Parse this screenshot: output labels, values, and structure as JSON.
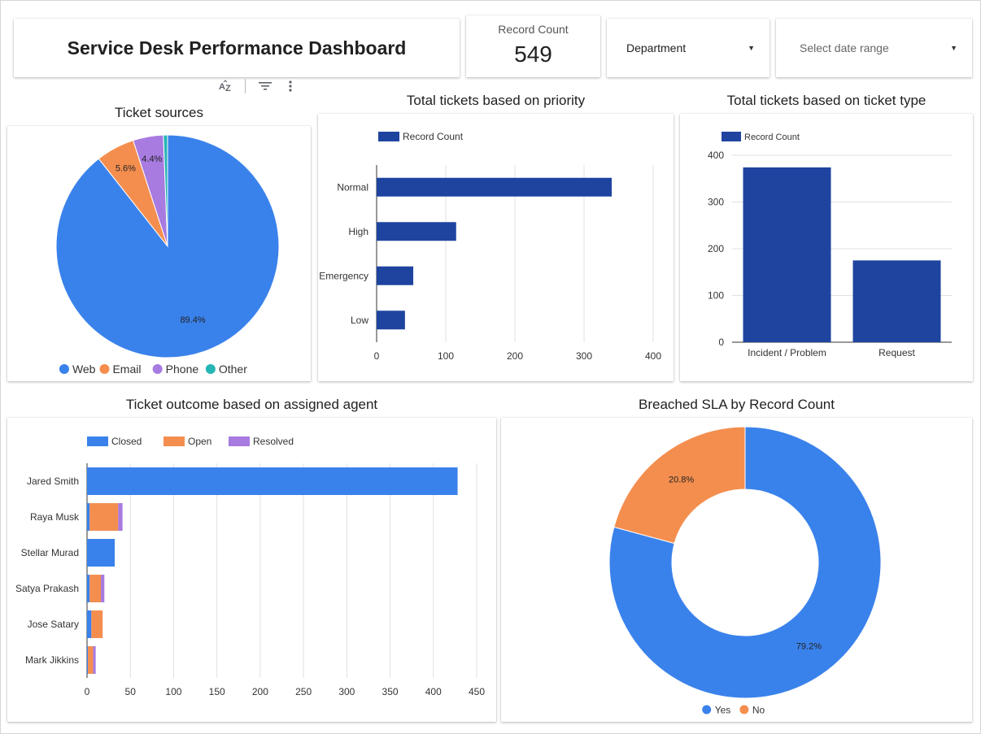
{
  "dashboard": {
    "title": "Service Desk Performance Dashboard"
  },
  "scorecard": {
    "label": "Record Count",
    "value": "549"
  },
  "filters": {
    "department": {
      "label": "Department"
    },
    "date_range": {
      "placeholder": "Select date range"
    }
  },
  "toolbar": {
    "sort_icon_text": "ÃZ"
  },
  "colors": {
    "blue": "#3A82EB",
    "orange": "#F48E4F",
    "purple": "#A77BE0",
    "teal": "#26B5B5",
    "navy": "#1E44A0",
    "grid": "#e0e0e0"
  },
  "chart_data": [
    {
      "id": "ticket_sources",
      "type": "pie",
      "title": "Ticket sources",
      "labels": [
        "Web",
        "Email",
        "Phone",
        "Other"
      ],
      "values": [
        89.4,
        5.6,
        4.4,
        0.6
      ],
      "label_texts": [
        "89.4%",
        "5.6%",
        "4.4%",
        ""
      ],
      "colors": [
        "#3A82EB",
        "#F48E4F",
        "#A77BE0",
        "#26B5B5"
      ],
      "legend_position": "bottom"
    },
    {
      "id": "priority",
      "type": "bar",
      "orientation": "horizontal",
      "title": "Total tickets based on priority",
      "categories": [
        "Normal",
        "High",
        "Emergency",
        "Low"
      ],
      "series": [
        {
          "name": "Record Count",
          "values": [
            340,
            115,
            53,
            41
          ]
        }
      ],
      "xlim": [
        0,
        400
      ],
      "x_ticks": [
        0,
        100,
        200,
        300,
        400
      ],
      "grid": true,
      "legend_position": "top-left"
    },
    {
      "id": "ticket_type",
      "type": "bar",
      "orientation": "vertical",
      "title": "Total tickets based on ticket type",
      "categories": [
        "Incident / Problem",
        "Request"
      ],
      "series": [
        {
          "name": "Record Count",
          "values": [
            374,
            175
          ]
        }
      ],
      "ylim": [
        0,
        400
      ],
      "y_ticks": [
        0,
        100,
        200,
        300,
        400
      ],
      "grid": true,
      "legend_position": "top-left"
    },
    {
      "id": "agent_outcome",
      "type": "bar",
      "orientation": "horizontal",
      "stacked": true,
      "title": "Ticket outcome based on assigned agent",
      "categories": [
        "Jared Smith",
        "Raya Musk",
        "Stellar Murad",
        "Satya Prakash",
        "Jose Satary",
        "Mark Jikkins"
      ],
      "series": [
        {
          "name": "Closed",
          "values": [
            428,
            3,
            32,
            3,
            5,
            1
          ]
        },
        {
          "name": "Open",
          "values": [
            0,
            33,
            0,
            13,
            13,
            6
          ]
        },
        {
          "name": "Resolved",
          "values": [
            0,
            5,
            0,
            4,
            0,
            3
          ]
        }
      ],
      "xlim": [
        0,
        450
      ],
      "x_ticks": [
        0,
        50,
        100,
        150,
        200,
        250,
        300,
        350,
        400,
        450
      ],
      "grid": true,
      "legend_position": "top-left"
    },
    {
      "id": "breached_sla",
      "type": "pie",
      "donut": true,
      "title": "Breached SLA by Record Count",
      "labels": [
        "Yes",
        "No"
      ],
      "values": [
        79.2,
        20.8
      ],
      "label_texts": [
        "79.2%",
        "20.8%"
      ],
      "colors": [
        "#3A82EB",
        "#F48E4F"
      ],
      "legend_position": "bottom"
    }
  ]
}
